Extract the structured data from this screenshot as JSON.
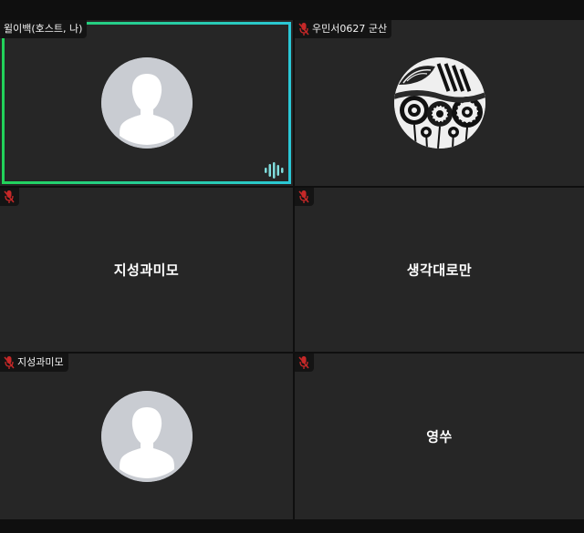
{
  "participants": [
    {
      "tag": "윌이백(호스트, 나)",
      "avatar": "default-person-icon",
      "active_speaker": true,
      "muted": false
    },
    {
      "tag": "우민서0627 군산",
      "avatar": "patterned-photo",
      "muted": true
    },
    {
      "tag": "",
      "display_name": "지성과미모",
      "muted": true
    },
    {
      "tag": "",
      "display_name": "생각대로만",
      "muted": true
    },
    {
      "tag": "지성과미모",
      "avatar": "default-person-icon",
      "muted": true
    },
    {
      "tag": "",
      "display_name": "영쑤",
      "muted": true
    }
  ],
  "colors": {
    "active_border_start": "#22d35a",
    "active_border_end": "#2bc7d6",
    "muted_mic": "#c62828",
    "tile_bg": "#262626"
  }
}
